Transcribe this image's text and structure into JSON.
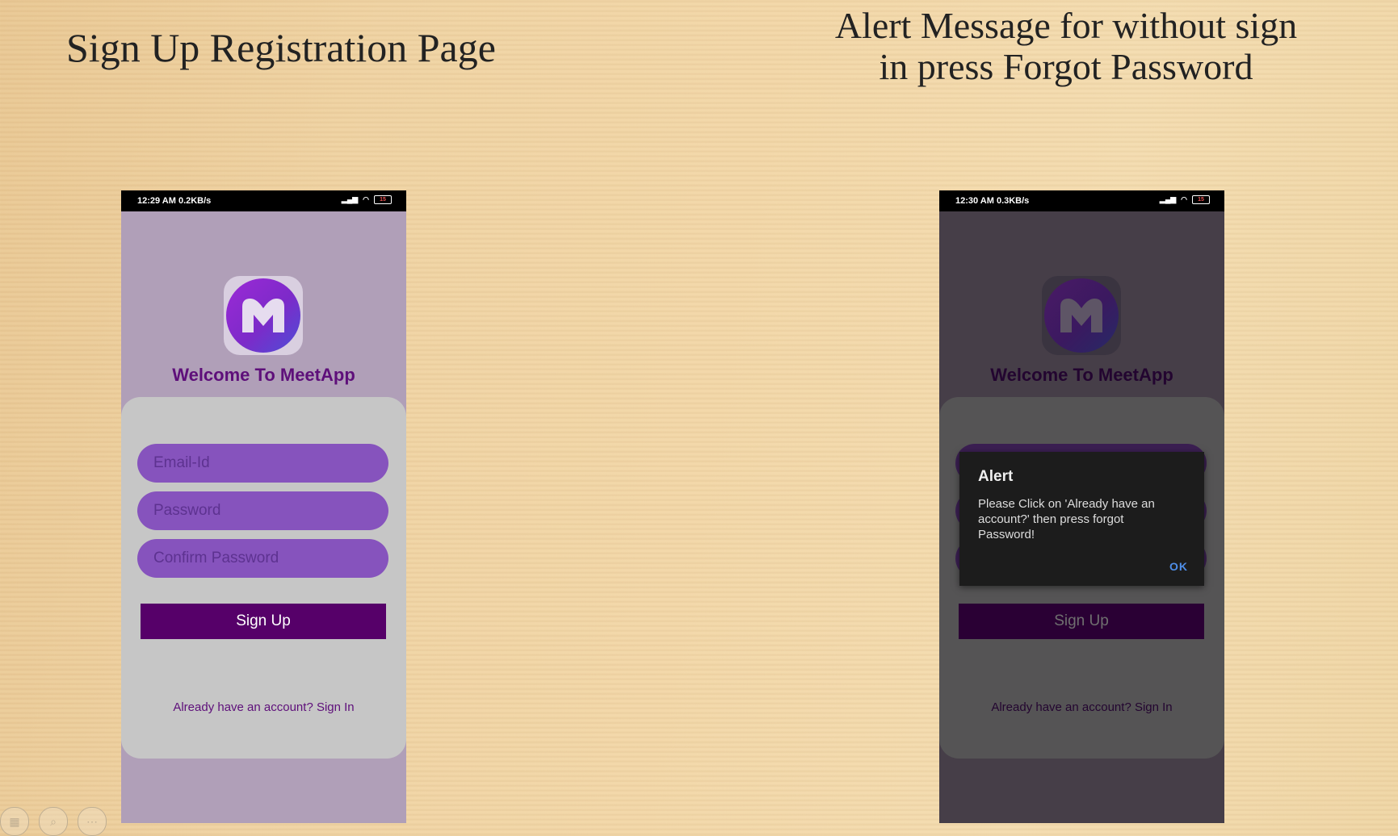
{
  "slide": {
    "left_title": "Sign Up Registration Page",
    "right_title_line1": "Alert Message for without sign",
    "right_title_line2": "in press Forgot Password"
  },
  "left_phone": {
    "status_time": "12:29 AM  0.2KB/s",
    "battery": "15",
    "welcome": "Welcome To MeetApp",
    "email_placeholder": "Email-Id",
    "password_placeholder": "Password",
    "confirm_placeholder": "Confirm Password",
    "signup_label": "Sign Up",
    "signin_link": "Already have an account? Sign In"
  },
  "right_phone": {
    "status_time": "12:30 AM  0.3KB/s",
    "battery": "15",
    "welcome": "Welcome To MeetApp",
    "signup_label": "Sign Up",
    "signin_link": "Already have an account? Sign In",
    "alert": {
      "title": "Alert",
      "message": "Please Click on 'Already have an account?' then press forgot Password!",
      "ok_label": "OK"
    }
  },
  "colors": {
    "brand_purple": "#560069",
    "field_purple": "#8653bd",
    "link_purple": "#5e0f7a"
  }
}
